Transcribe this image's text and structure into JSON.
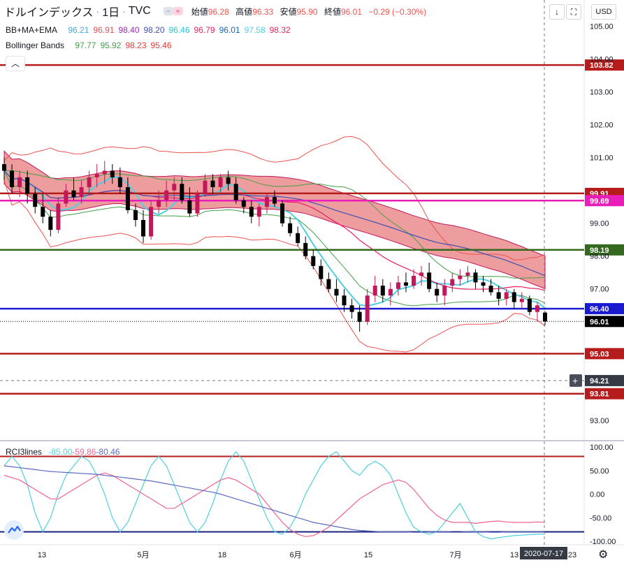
{
  "header": {
    "symbol": "ドルインデックス",
    "timeframe": "1日",
    "source": "TVC",
    "ohlc": [
      {
        "label": "始値",
        "value": "96.28"
      },
      {
        "label": "高値",
        "value": "96.33"
      },
      {
        "label": "安値",
        "value": "95.90"
      },
      {
        "label": "終値",
        "value": "96.01"
      }
    ],
    "change": "−0.29 (−0.30%)"
  },
  "legend_bbmaema": {
    "label": "BB+MA+EMA",
    "values": [
      {
        "v": "96.21",
        "color": "#4aa8d8"
      },
      {
        "v": "96.91",
        "color": "#e05050"
      },
      {
        "v": "98.40",
        "color": "#9c27b0"
      },
      {
        "v": "98.20",
        "color": "#3f51b5"
      },
      {
        "v": "96.46",
        "color": "#26c6da"
      },
      {
        "v": "96.79",
        "color": "#e91e63"
      },
      {
        "v": "96.01",
        "color": "#1565c0"
      },
      {
        "v": "97.58",
        "color": "#4dd0e1"
      },
      {
        "v": "98.32",
        "color": "#e91e63"
      }
    ]
  },
  "legend_bb": {
    "label": "Bollinger Bands",
    "values": [
      {
        "v": "97.77",
        "color": "#43a047"
      },
      {
        "v": "95.92",
        "color": "#43a047"
      },
      {
        "v": "98.23",
        "color": "#e53935"
      },
      {
        "v": "95.46",
        "color": "#e53935"
      }
    ]
  },
  "legend_rci": {
    "label": "RCI3lines",
    "values": [
      {
        "v": "-85.00",
        "color": "#4dd0e1"
      },
      {
        "v": "-59.86",
        "color": "#f06292"
      },
      {
        "v": "-80.46",
        "color": "#5c6bc0"
      }
    ]
  },
  "toolbar": {
    "currency": "USD",
    "collapse": "︿",
    "download": "↓",
    "fullscreen": "⛶",
    "add": "+"
  },
  "icons": [
    "chevron-up-icon",
    "download-icon",
    "fullscreen-icon",
    "gear-icon",
    "tradingview-logo-icon",
    "plus-icon"
  ],
  "colors": {
    "up": "#c2185b",
    "down": "#000000",
    "bg": "#ffffff"
  },
  "chart_data": {
    "type": "candlestick",
    "price_axis": {
      "range": [
        92.4,
        105.8
      ],
      "ticks": [
        "105.00",
        "104.00",
        "103.00",
        "102.00",
        "101.00",
        "99.00",
        "98.00",
        "97.00",
        "93.00"
      ],
      "tick_values": [
        105,
        104,
        103,
        102,
        101,
        99,
        98,
        97,
        93
      ]
    },
    "time_axis": {
      "labels": [
        "13",
        "5月",
        "18",
        "6月",
        "15",
        "7月",
        "13",
        "23"
      ],
      "crosshair_date": "2020-07-17"
    },
    "horizontal_lines": [
      {
        "price": 103.82,
        "label": "103.82",
        "color": "#b71c1c"
      },
      {
        "price": 99.91,
        "label": "99.91",
        "color": "#b71c1c"
      },
      {
        "price": 99.69,
        "label": "99.69",
        "color": "#e91eb8"
      },
      {
        "price": 98.19,
        "label": "98.19",
        "color": "#33691e"
      },
      {
        "price": 96.4,
        "label": "96.40",
        "color": "#1a1ad0"
      },
      {
        "price": 95.03,
        "label": "95.03",
        "color": "#b71c1c"
      },
      {
        "price": 93.81,
        "label": "93.81",
        "color": "#b71c1c"
      }
    ],
    "last_price": {
      "price": 96.01,
      "label": "96.01"
    },
    "crosshair_price": {
      "price": 94.21,
      "label": "94.21"
    },
    "candles": [
      [
        100.8,
        101.0,
        100.3,
        100.6
      ],
      [
        100.6,
        100.8,
        99.9,
        100.1
      ],
      [
        100.1,
        100.6,
        99.8,
        100.4
      ],
      [
        100.4,
        100.6,
        99.6,
        99.9
      ],
      [
        99.9,
        100.1,
        99.3,
        99.5
      ],
      [
        99.5,
        99.9,
        99.0,
        99.2
      ],
      [
        99.2,
        99.4,
        98.6,
        98.8
      ],
      [
        98.8,
        99.8,
        98.7,
        99.6
      ],
      [
        99.6,
        100.2,
        99.5,
        100.0
      ],
      [
        100.0,
        100.4,
        99.7,
        99.8
      ],
      [
        99.8,
        100.3,
        99.6,
        100.1
      ],
      [
        100.1,
        100.6,
        99.9,
        100.4
      ],
      [
        100.4,
        100.8,
        100.1,
        100.5
      ],
      [
        100.5,
        100.9,
        100.2,
        100.6
      ],
      [
        100.6,
        100.8,
        100.2,
        100.4
      ],
      [
        100.4,
        100.7,
        99.9,
        100.1
      ],
      [
        100.1,
        100.4,
        99.3,
        99.4
      ],
      [
        99.4,
        99.6,
        98.9,
        99.1
      ],
      [
        99.1,
        99.4,
        98.4,
        98.6
      ],
      [
        98.6,
        99.7,
        98.5,
        99.5
      ],
      [
        99.5,
        100.0,
        99.3,
        99.7
      ],
      [
        99.7,
        100.3,
        99.5,
        100.0
      ],
      [
        100.0,
        100.4,
        99.7,
        100.2
      ],
      [
        100.2,
        100.4,
        99.6,
        99.7
      ],
      [
        99.7,
        100.1,
        99.2,
        99.3
      ],
      [
        99.3,
        100.0,
        99.2,
        99.9
      ],
      [
        99.9,
        100.5,
        99.8,
        100.3
      ],
      [
        100.3,
        100.5,
        99.9,
        100.1
      ],
      [
        100.1,
        100.5,
        99.9,
        100.4
      ],
      [
        100.4,
        100.6,
        100.0,
        100.2
      ],
      [
        100.2,
        100.4,
        99.6,
        99.7
      ],
      [
        99.7,
        99.8,
        99.3,
        99.5
      ],
      [
        99.5,
        99.7,
        99.0,
        99.2
      ],
      [
        99.2,
        99.6,
        98.9,
        99.5
      ],
      [
        99.5,
        99.9,
        99.3,
        99.8
      ],
      [
        99.8,
        100.0,
        99.5,
        99.6
      ],
      [
        99.6,
        99.7,
        98.9,
        99.0
      ],
      [
        99.0,
        99.2,
        98.6,
        98.7
      ],
      [
        98.7,
        98.9,
        98.3,
        98.4
      ],
      [
        98.4,
        98.6,
        97.9,
        98.0
      ],
      [
        98.0,
        98.2,
        97.6,
        97.7
      ],
      [
        97.7,
        97.9,
        97.1,
        97.3
      ],
      [
        97.3,
        97.5,
        96.9,
        97.0
      ],
      [
        97.0,
        97.3,
        96.6,
        96.8
      ],
      [
        96.8,
        97.0,
        96.3,
        96.5
      ],
      [
        96.5,
        96.7,
        96.1,
        96.3
      ],
      [
        96.3,
        96.5,
        95.7,
        96.0
      ],
      [
        96.0,
        97.0,
        95.9,
        96.8
      ],
      [
        96.8,
        97.4,
        96.6,
        97.1
      ],
      [
        97.1,
        97.3,
        96.6,
        96.8
      ],
      [
        96.8,
        97.2,
        96.5,
        97.0
      ],
      [
        97.0,
        97.4,
        96.8,
        97.2
      ],
      [
        97.2,
        97.5,
        96.9,
        97.1
      ],
      [
        97.1,
        97.6,
        97.0,
        97.4
      ],
      [
        97.4,
        97.7,
        97.1,
        97.5
      ],
      [
        97.5,
        97.8,
        96.9,
        97.0
      ],
      [
        97.0,
        97.2,
        96.6,
        96.8
      ],
      [
        96.8,
        97.3,
        96.5,
        97.1
      ],
      [
        97.1,
        97.5,
        96.9,
        97.3
      ],
      [
        97.3,
        97.6,
        97.1,
        97.4
      ],
      [
        97.4,
        97.7,
        97.2,
        97.5
      ],
      [
        97.5,
        97.6,
        97.0,
        97.2
      ],
      [
        97.2,
        97.4,
        96.9,
        97.1
      ],
      [
        97.1,
        97.3,
        96.8,
        96.9
      ],
      [
        96.9,
        97.1,
        96.5,
        96.7
      ],
      [
        96.7,
        97.0,
        96.5,
        96.9
      ],
      [
        96.9,
        97.0,
        96.4,
        96.6
      ],
      [
        96.6,
        96.9,
        96.4,
        96.7
      ],
      [
        96.7,
        96.8,
        96.2,
        96.3
      ],
      [
        96.3,
        96.6,
        96.0,
        96.5
      ],
      [
        96.28,
        96.33,
        95.9,
        96.01
      ]
    ],
    "rci_axis": {
      "ticks": [
        "100.00",
        "50.00",
        "0.00",
        "-50.00",
        "-100.00"
      ],
      "tick_values": [
        100,
        50,
        0,
        -50,
        -100
      ]
    },
    "rci_lines": [
      {
        "value": 80
      },
      {
        "value": -80
      }
    ],
    "rci_series": {
      "short": [
        60,
        80,
        60,
        20,
        -40,
        -80,
        -50,
        0,
        40,
        60,
        80,
        70,
        40,
        0,
        -50,
        -80,
        -60,
        -20,
        20,
        60,
        80,
        60,
        20,
        -20,
        -60,
        -80,
        -60,
        -20,
        30,
        70,
        90,
        70,
        30,
        -10,
        -50,
        -80,
        -85,
        -70,
        -40,
        0,
        30,
        60,
        80,
        90,
        70,
        50,
        40,
        60,
        70,
        60,
        40,
        0,
        -40,
        -70,
        -80,
        -85,
        -80,
        -60,
        -40,
        -20,
        -50,
        -80,
        -90,
        -95,
        -92,
        -90,
        -88,
        -87,
        -86,
        -85,
        -85
      ],
      "mid": [
        40,
        35,
        30,
        20,
        10,
        0,
        -10,
        -10,
        0,
        10,
        20,
        30,
        40,
        45,
        40,
        30,
        20,
        10,
        0,
        -10,
        -20,
        -30,
        -30,
        -20,
        -10,
        0,
        10,
        20,
        30,
        35,
        30,
        20,
        10,
        0,
        -20,
        -40,
        -60,
        -75,
        -85,
        -90,
        -88,
        -80,
        -70,
        -55,
        -40,
        -25,
        -10,
        0,
        10,
        20,
        25,
        30,
        25,
        10,
        -10,
        -30,
        -45,
        -55,
        -60,
        -60,
        -60,
        -62,
        -60,
        -58,
        -57,
        -59,
        -60,
        -60,
        -60,
        -59,
        -59.86
      ],
      "long": [
        60,
        58,
        56,
        54,
        52,
        50,
        48,
        47,
        46,
        45,
        44,
        43,
        42,
        40,
        38,
        36,
        34,
        32,
        30,
        28,
        25,
        22,
        19,
        16,
        13,
        10,
        7,
        4,
        0,
        -5,
        -10,
        -15,
        -20,
        -25,
        -30,
        -35,
        -40,
        -45,
        -50,
        -55,
        -60,
        -63,
        -66,
        -69,
        -72,
        -75,
        -77,
        -78,
        -79,
        -80,
        -80,
        -80,
        -80,
        -81,
        -81,
        -80,
        -80,
        -80,
        -79,
        -79,
        -80,
        -80,
        -80,
        -81,
        -81,
        -80,
        -80,
        -80,
        -80,
        -80,
        -80.46
      ]
    }
  }
}
